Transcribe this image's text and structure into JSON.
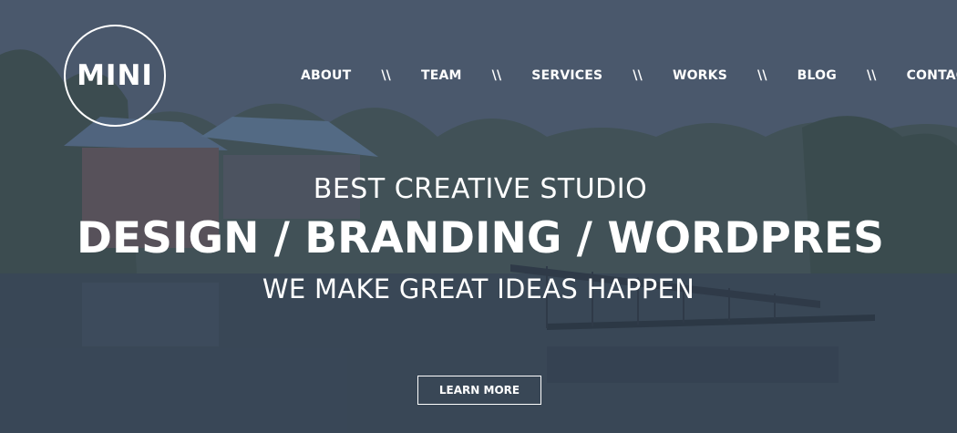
{
  "logo": {
    "text": "MINI"
  },
  "nav": {
    "items": [
      {
        "label": "ABOUT"
      },
      {
        "label": "TEAM"
      },
      {
        "label": "SERVICES"
      },
      {
        "label": "WORKS"
      },
      {
        "label": "BLOG"
      },
      {
        "label": "CONTACT"
      }
    ],
    "separator": "\\\\"
  },
  "hero": {
    "kicker": "BEST CREATIVE STUDIO",
    "title": "DESIGN / BRANDING / WORDPRES",
    "subtitle": "WE MAKE GREAT IDEAS HAPPEN",
    "cta_label": "LEARN MORE"
  },
  "colors": {
    "text": "#ffffff",
    "overlay": "#4b5a6e"
  }
}
